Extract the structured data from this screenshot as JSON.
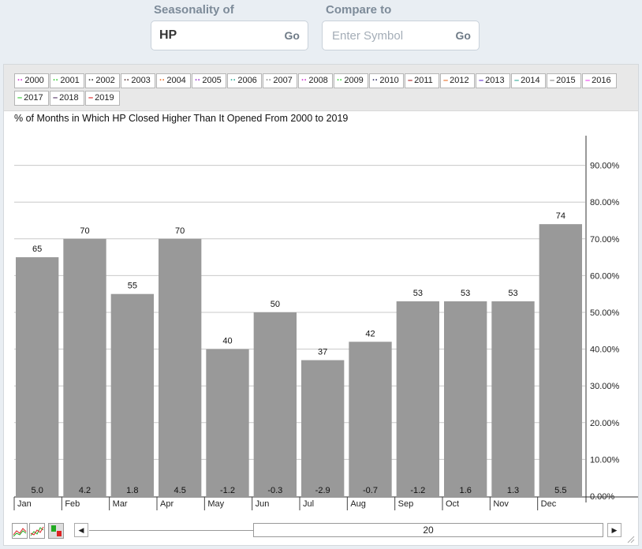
{
  "search": {
    "seasonality_label": "Seasonality of",
    "symbol_value": "HP",
    "go_label": "Go",
    "compare_label": "Compare to",
    "compare_placeholder": "Enter Symbol",
    "compare_go_label": "Go"
  },
  "legend": [
    {
      "year": "2000",
      "color": "#cc33cc",
      "style": "dotted"
    },
    {
      "year": "2001",
      "color": "#33cc33",
      "style": "dotted"
    },
    {
      "year": "2002",
      "color": "#333333",
      "style": "dotted"
    },
    {
      "year": "2003",
      "color": "#553333",
      "style": "dotted"
    },
    {
      "year": "2004",
      "color": "#e8702a",
      "style": "dotted"
    },
    {
      "year": "2005",
      "color": "#9933cc",
      "style": "dotted"
    },
    {
      "year": "2006",
      "color": "#33aa99",
      "style": "dotted"
    },
    {
      "year": "2007",
      "color": "#888888",
      "style": "dotted"
    },
    {
      "year": "2008",
      "color": "#cc33cc",
      "style": "dotted"
    },
    {
      "year": "2009",
      "color": "#33cc33",
      "style": "dotted"
    },
    {
      "year": "2010",
      "color": "#333366",
      "style": "dotted"
    },
    {
      "year": "2011",
      "color": "#aa2222",
      "style": "solid"
    },
    {
      "year": "2012",
      "color": "#e8702a",
      "style": "solid"
    },
    {
      "year": "2013",
      "color": "#6633cc",
      "style": "solid"
    },
    {
      "year": "2014",
      "color": "#33aa99",
      "style": "solid"
    },
    {
      "year": "2015",
      "color": "#888888",
      "style": "solid"
    },
    {
      "year": "2016",
      "color": "#ee44ee",
      "style": "solid"
    },
    {
      "year": "2017",
      "color": "#33cc33",
      "style": "solid"
    },
    {
      "year": "2018",
      "color": "#553366",
      "style": "solid"
    },
    {
      "year": "2019",
      "color": "#dd2222",
      "style": "solid"
    }
  ],
  "chart_data": {
    "type": "bar",
    "title": "% of Months in Which HP Closed Higher Than It Opened From 2000 to 2019",
    "categories": [
      "Jan",
      "Feb",
      "Mar",
      "Apr",
      "May",
      "Jun",
      "Jul",
      "Aug",
      "Sep",
      "Oct",
      "Nov",
      "Dec"
    ],
    "values": [
      65,
      70,
      55,
      70,
      40,
      50,
      37,
      42,
      53,
      53,
      53,
      74
    ],
    "avg_change": [
      "5.0",
      "4.2",
      "1.8",
      "4.5",
      "-1.2",
      "-0.3",
      "-2.9",
      "-0.7",
      "-1.2",
      "1.6",
      "1.3",
      "5.5"
    ],
    "ylim": [
      0,
      100
    ],
    "yticks": [
      "0.00%",
      "10.00%",
      "20.00%",
      "30.00%",
      "40.00%",
      "50.00%",
      "60.00%",
      "70.00%",
      "80.00%",
      "90.00%"
    ],
    "bar_color": "#999999",
    "grid": true,
    "legend_position": "top"
  },
  "controls": {
    "range_label": "20",
    "left_arrow": "◀",
    "right_arrow": "▶"
  }
}
